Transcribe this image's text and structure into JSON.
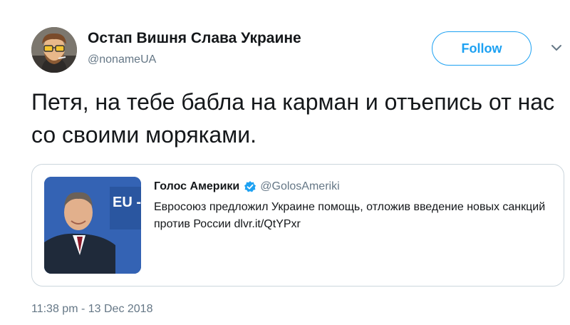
{
  "author": {
    "display_name": "Остап Вишня Слава Украине",
    "handle": "@nonameUA",
    "avatar": "avatar-portrait"
  },
  "follow_label": "Follow",
  "caret_icon": "chevron-down-icon",
  "tweet": {
    "text": "Петя, на тебе бабла на карман и отъепись от нас со своими моряками."
  },
  "quoted": {
    "name": "Голос Америки",
    "verified_icon": "verified-badge-icon",
    "handle": "@GolosAmeriki",
    "text": "Евросоюз предложил Украине помощь, отложив введение новых санкций против России dlvr.it/QtYPxr",
    "image_text": "EU - Ca"
  },
  "timestamp": "11:38 pm - 13 Dec 2018",
  "colors": {
    "accent": "#1da1f2",
    "text": "#14171a",
    "secondary": "#657786",
    "border": "#ccd6dd"
  }
}
